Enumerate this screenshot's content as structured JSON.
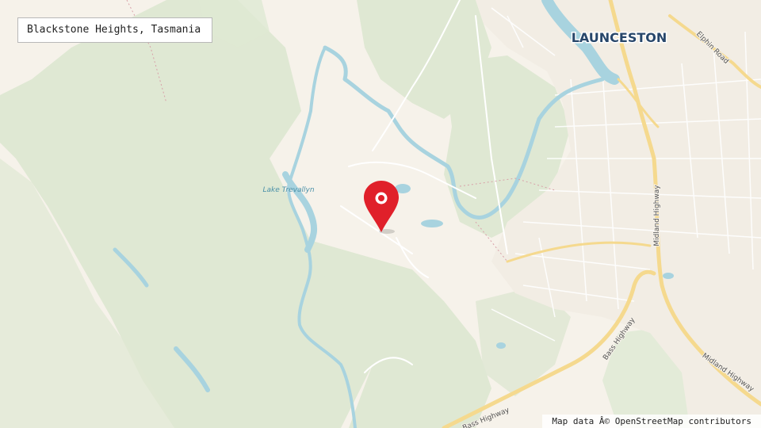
{
  "search": {
    "value": "Blackstone Heights, Tasmania"
  },
  "map": {
    "labels": {
      "city": "LAUNCESTON",
      "lake": "Lake Trevallyn",
      "road_elphin": "Elphin Road",
      "road_midland_1": "Midland Highway",
      "road_midland_2": "Midland Highway",
      "road_bass_1": "Bass Highway",
      "road_bass_2": "Bass Highway"
    },
    "marker": {
      "color": "#e0202a"
    },
    "colors": {
      "land": "#f6f2ea",
      "forest": "#dfe8d3",
      "water": "#a8d3df",
      "water_label": "#4a90a8",
      "road_major": "#f5d98e",
      "road_minor": "#ffffff"
    }
  },
  "attribution": {
    "text": "Map data Â© OpenStreetMap contributors"
  }
}
